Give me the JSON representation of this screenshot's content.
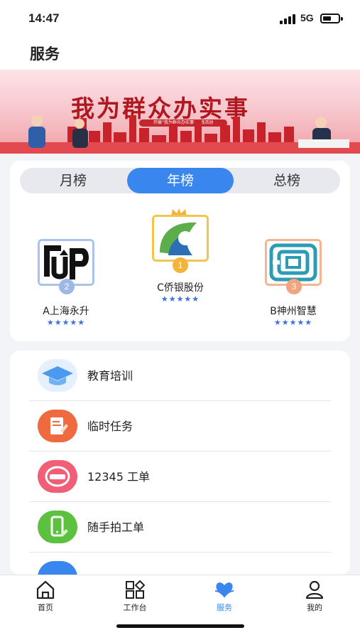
{
  "status_bar": {
    "time": "14:47",
    "network": "5G",
    "icons": [
      "signal-icon",
      "battery-icon"
    ]
  },
  "header": {
    "title": "服务"
  },
  "banner": {
    "title": "我为群众办实事",
    "subtitle": "开展“我为群众办实事”实践活动",
    "colors": {
      "title": "#b0171f",
      "background": "#f7c9cf"
    }
  },
  "ranking": {
    "tabs": [
      {
        "label": "月榜",
        "active": false
      },
      {
        "label": "年榜",
        "active": true
      },
      {
        "label": "总榜",
        "active": false
      }
    ],
    "podium": [
      {
        "rank": "1",
        "name": "C侨银股份",
        "rating": 5,
        "stars": "★★★★★",
        "badge_color": "#f4b43a",
        "frame_color": "#f3c44e"
      },
      {
        "rank": "2",
        "name": "A上海永升",
        "rating": 5,
        "stars": "★★★★★",
        "badge_color": "#9db8e6",
        "frame_color": "#a9c4ec"
      },
      {
        "rank": "3",
        "name": "B神州智慧",
        "rating": 5,
        "stars": "★★★★★",
        "badge_color": "#f1a47d",
        "frame_color": "#f3b592"
      }
    ]
  },
  "services": [
    {
      "label": "教育培训",
      "icon": "graduation-cap-icon",
      "color": "#4a9bf0"
    },
    {
      "label": "临时任务",
      "icon": "task-note-icon",
      "color": "#ef6a3e"
    },
    {
      "label": "12345 工单",
      "icon": "hotline-12345-icon",
      "color": "#f05f75"
    },
    {
      "label": "随手拍工单",
      "icon": "phone-camera-icon",
      "color": "#5cc13f"
    }
  ],
  "tabbar": {
    "items": [
      {
        "label": "首页",
        "icon": "home-icon",
        "active": false
      },
      {
        "label": "工作台",
        "icon": "workbench-icon",
        "active": false
      },
      {
        "label": "服务",
        "icon": "heart-hand-icon",
        "active": true
      },
      {
        "label": "我的",
        "icon": "user-icon",
        "active": false
      }
    ],
    "active_color": "#3a86ef"
  }
}
